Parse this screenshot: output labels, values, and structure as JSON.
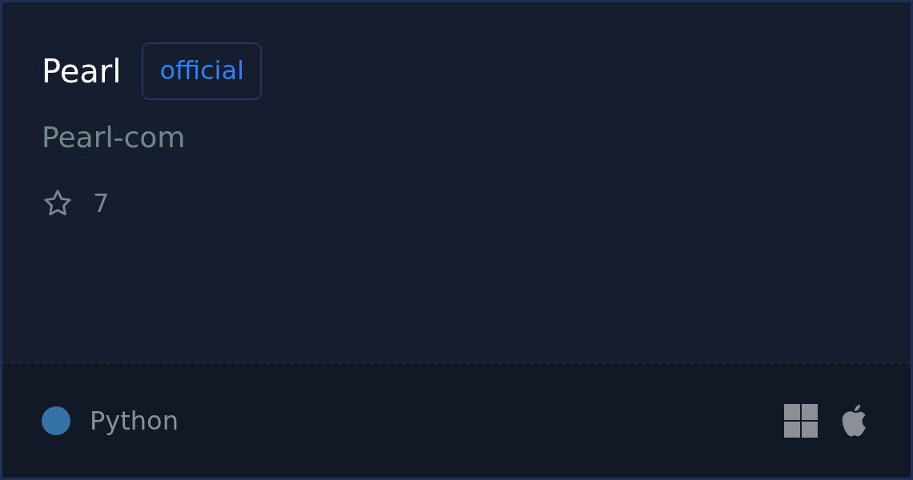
{
  "card": {
    "title": "Pearl",
    "badge": "official",
    "owner": "Pearl-com",
    "star_count": "7"
  },
  "footer": {
    "language": {
      "name": "Python",
      "color": "#3572a5"
    },
    "platforms": [
      {
        "kind": "windows"
      },
      {
        "kind": "apple"
      }
    ]
  }
}
